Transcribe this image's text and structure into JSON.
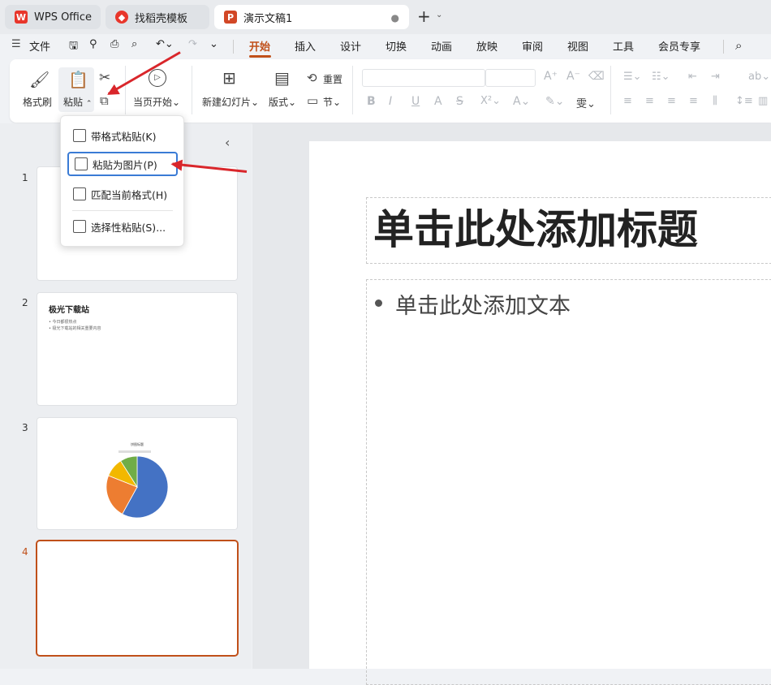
{
  "tabs": {
    "wps": "WPS Office",
    "template": "找稻壳模板",
    "doc": "演示文稿1",
    "new_tab": "+"
  },
  "menubar": {
    "file": "文件",
    "items": [
      "开始",
      "插入",
      "设计",
      "切换",
      "动画",
      "放映",
      "审阅",
      "视图",
      "工具",
      "会员专享"
    ]
  },
  "ribbon": {
    "format_painter": "格式刷",
    "paste": "粘贴",
    "from_current": "当页开始",
    "new_slide": "新建幻灯片",
    "layout": "版式",
    "reset": "重置",
    "section": "节"
  },
  "paste_menu": {
    "keep_format": "带格式粘贴(K)",
    "as_picture": "粘贴为图片(P)",
    "match_format": "匹配当前格式(H)",
    "selective": "选择性粘贴(S)..."
  },
  "thumbnails": {
    "numbers": [
      "1",
      "2",
      "3",
      "4"
    ],
    "slide2_title": "极光下载站",
    "slide2_bullets": [
      "今日都很热点",
      "极光下载站的相关重要内容"
    ],
    "slide3_title": "饼图标题"
  },
  "slide": {
    "title_placeholder": "单击此处添加标题",
    "body_placeholder": "单击此处添加文本"
  },
  "chart_data": {
    "type": "pie",
    "values": [
      58,
      23,
      10,
      9
    ],
    "colors": [
      "#4472c4",
      "#ed7d31",
      "#f2b800",
      "#70ad47"
    ]
  },
  "colors": {
    "accent": "#c0501a",
    "annotation_arrow": "#d9262b"
  }
}
